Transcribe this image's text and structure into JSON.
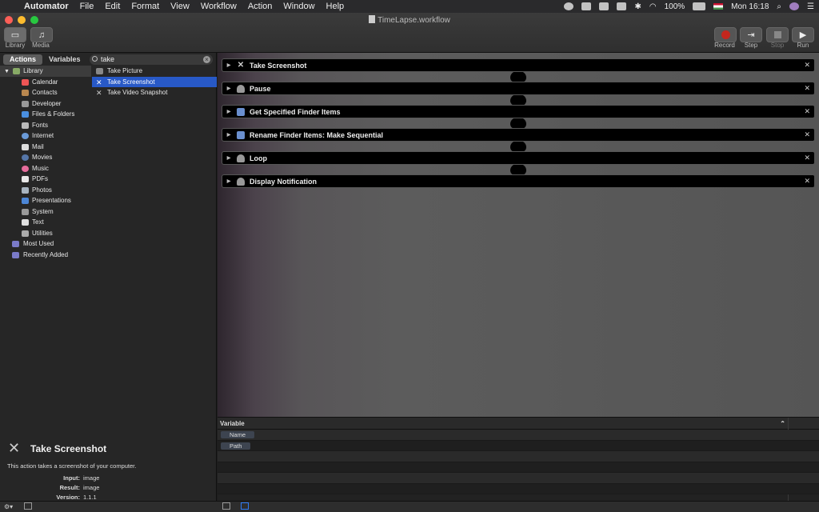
{
  "menubar": {
    "app_name": "Automator",
    "menus": [
      "File",
      "Edit",
      "Format",
      "View",
      "Workflow",
      "Action",
      "Window",
      "Help"
    ],
    "battery": "100%",
    "clock": "Mon 16:18"
  },
  "window": {
    "title": "TimeLapse.workflow"
  },
  "toolbar": {
    "library_label": "Library",
    "media_label": "Media",
    "record_label": "Record",
    "step_label": "Step",
    "stop_label": "Stop",
    "run_label": "Run"
  },
  "library": {
    "tab_actions": "Actions",
    "tab_variables": "Variables",
    "search_value": "take",
    "root_label": "Library",
    "categories": [
      "Calendar",
      "Contacts",
      "Developer",
      "Files & Folders",
      "Fonts",
      "Internet",
      "Mail",
      "Movies",
      "Music",
      "PDFs",
      "Photos",
      "Presentations",
      "System",
      "Text",
      "Utilities"
    ],
    "other_groups": [
      "Most Used",
      "Recently Added"
    ],
    "results": [
      "Take Picture",
      "Take Screenshot",
      "Take Video Snapshot"
    ],
    "selected_result": "Take Screenshot"
  },
  "description": {
    "title": "Take Screenshot",
    "text": "This action takes a screenshot of your computer.",
    "input_label": "Input:",
    "input_value": "image",
    "result_label": "Result:",
    "result_value": "image",
    "version_label": "Version:",
    "version_value": "1.1.1"
  },
  "workflow": {
    "actions": [
      {
        "label": "Take Screenshot",
        "icon": "tools-icon"
      },
      {
        "label": "Pause",
        "icon": "robot-icon"
      },
      {
        "label": "Get Specified Finder Items",
        "icon": "finder-icon"
      },
      {
        "label": "Rename Finder Items: Make Sequential",
        "icon": "finder-icon"
      },
      {
        "label": "Loop",
        "icon": "robot-icon"
      },
      {
        "label": "Display Notification",
        "icon": "robot-icon"
      }
    ]
  },
  "variables": {
    "header": "Variable",
    "rows": [
      "Name",
      "Path"
    ]
  },
  "colors": {
    "selection": "#2859c7",
    "record": "#c4261d"
  }
}
